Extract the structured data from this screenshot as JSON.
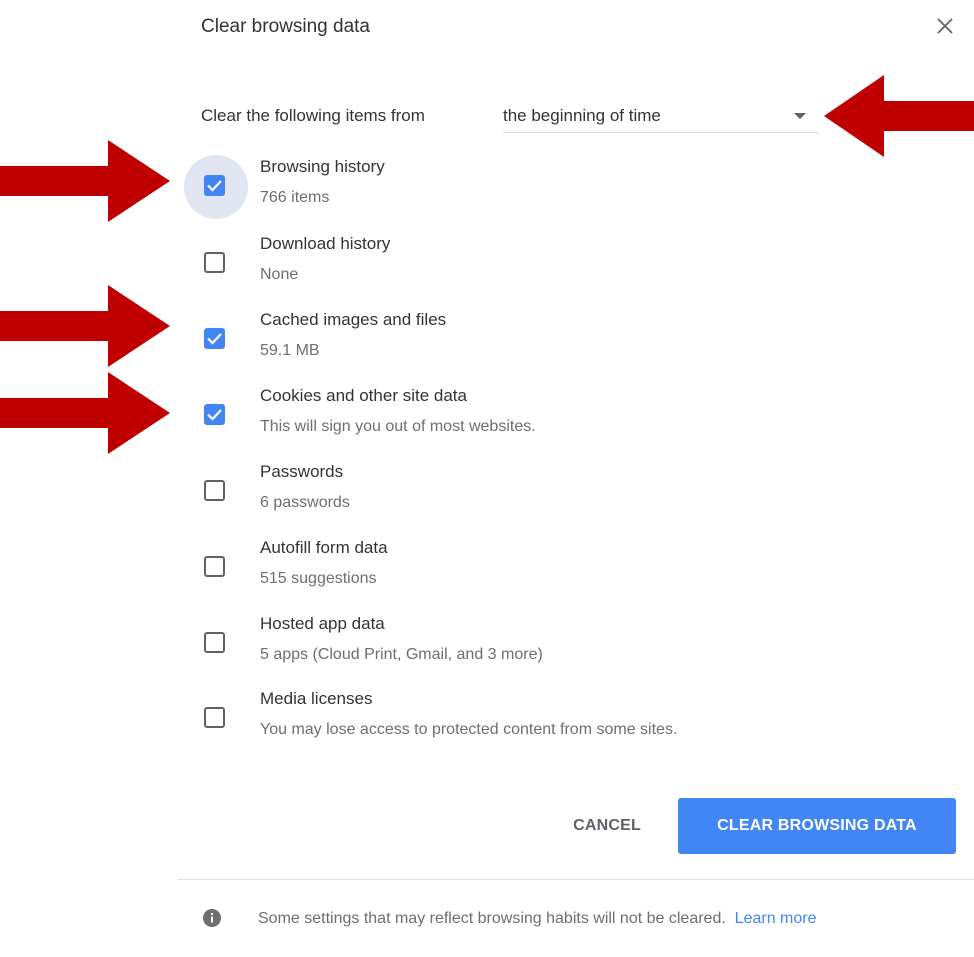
{
  "dialog": {
    "title": "Clear browsing data",
    "close_icon": "close-icon"
  },
  "time_range": {
    "label": "Clear the following items from",
    "selected": "the beginning of time"
  },
  "items": [
    {
      "title": "Browsing history",
      "subtitle": "766 items",
      "checked": true
    },
    {
      "title": "Download history",
      "subtitle": "None",
      "checked": false
    },
    {
      "title": "Cached images and files",
      "subtitle": "59.1 MB",
      "checked": true
    },
    {
      "title": "Cookies and other site data",
      "subtitle": "This will sign you out of most websites.",
      "checked": true
    },
    {
      "title": "Passwords",
      "subtitle": "6 passwords",
      "checked": false
    },
    {
      "title": "Autofill form data",
      "subtitle": "515 suggestions",
      "checked": false
    },
    {
      "title": "Hosted app data",
      "subtitle": "5 apps (Cloud Print, Gmail, and 3 more)",
      "checked": false
    },
    {
      "title": "Media licenses",
      "subtitle": "You may lose access to protected content from some sites.",
      "checked": false
    }
  ],
  "buttons": {
    "cancel_label": "CANCEL",
    "clear_label": "CLEAR BROWSING DATA"
  },
  "footer": {
    "note": "Some settings that may reflect browsing habits will not be cleared.",
    "link": "Learn more"
  },
  "colors": {
    "accent": "#4285f4",
    "arrow": "#c00000"
  }
}
